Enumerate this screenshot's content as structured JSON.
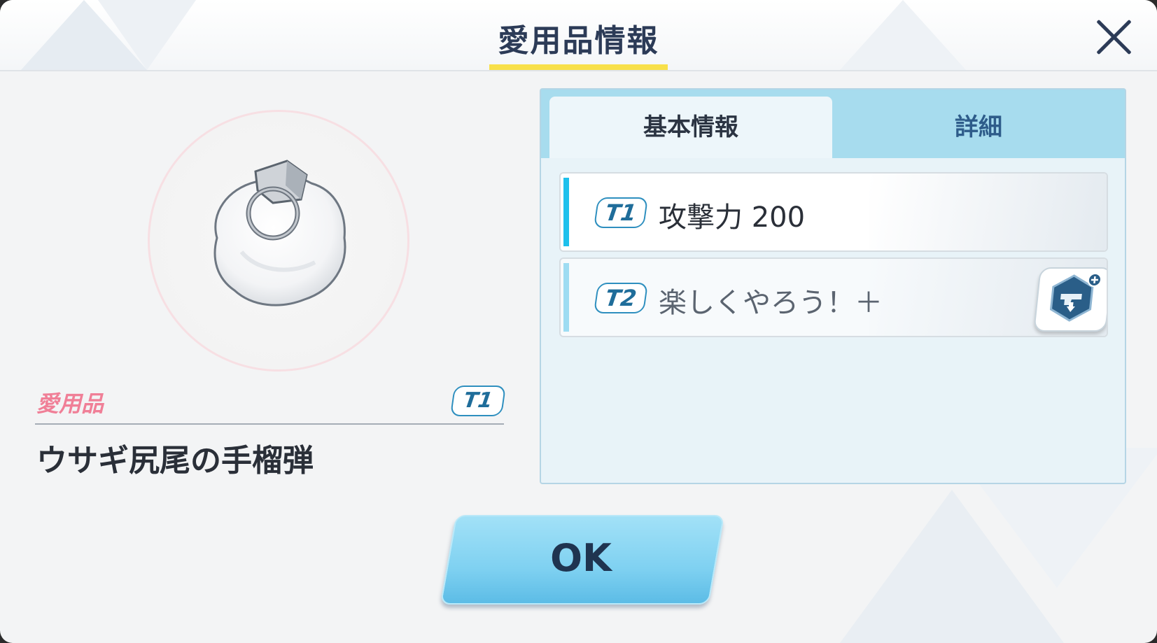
{
  "dialog": {
    "title": "愛用品情報",
    "close_icon": "close-icon"
  },
  "item": {
    "type_label": "愛用品",
    "tier": "T1",
    "name": "ウサギ尻尾の手榴弾",
    "image_icon": "grenade-icon"
  },
  "tabs": [
    {
      "label": "基本情報",
      "selected": true
    },
    {
      "label": "詳細",
      "selected": false
    }
  ],
  "stats": [
    {
      "tier": "T1",
      "text": "攻撃力 200"
    },
    {
      "tier": "T2",
      "text": "楽しくやろう！＋",
      "icon": "skill-upgrade-icon"
    }
  ],
  "ok_button": {
    "label": "OK"
  },
  "colors": {
    "title_text": "#2c3b57",
    "underline": "#f8e04a",
    "accent_pink": "#f07f97",
    "tier_blue": "#2e8fbf",
    "tab_bg": "#a7dcee",
    "ok_button": "#7fd1f1"
  }
}
